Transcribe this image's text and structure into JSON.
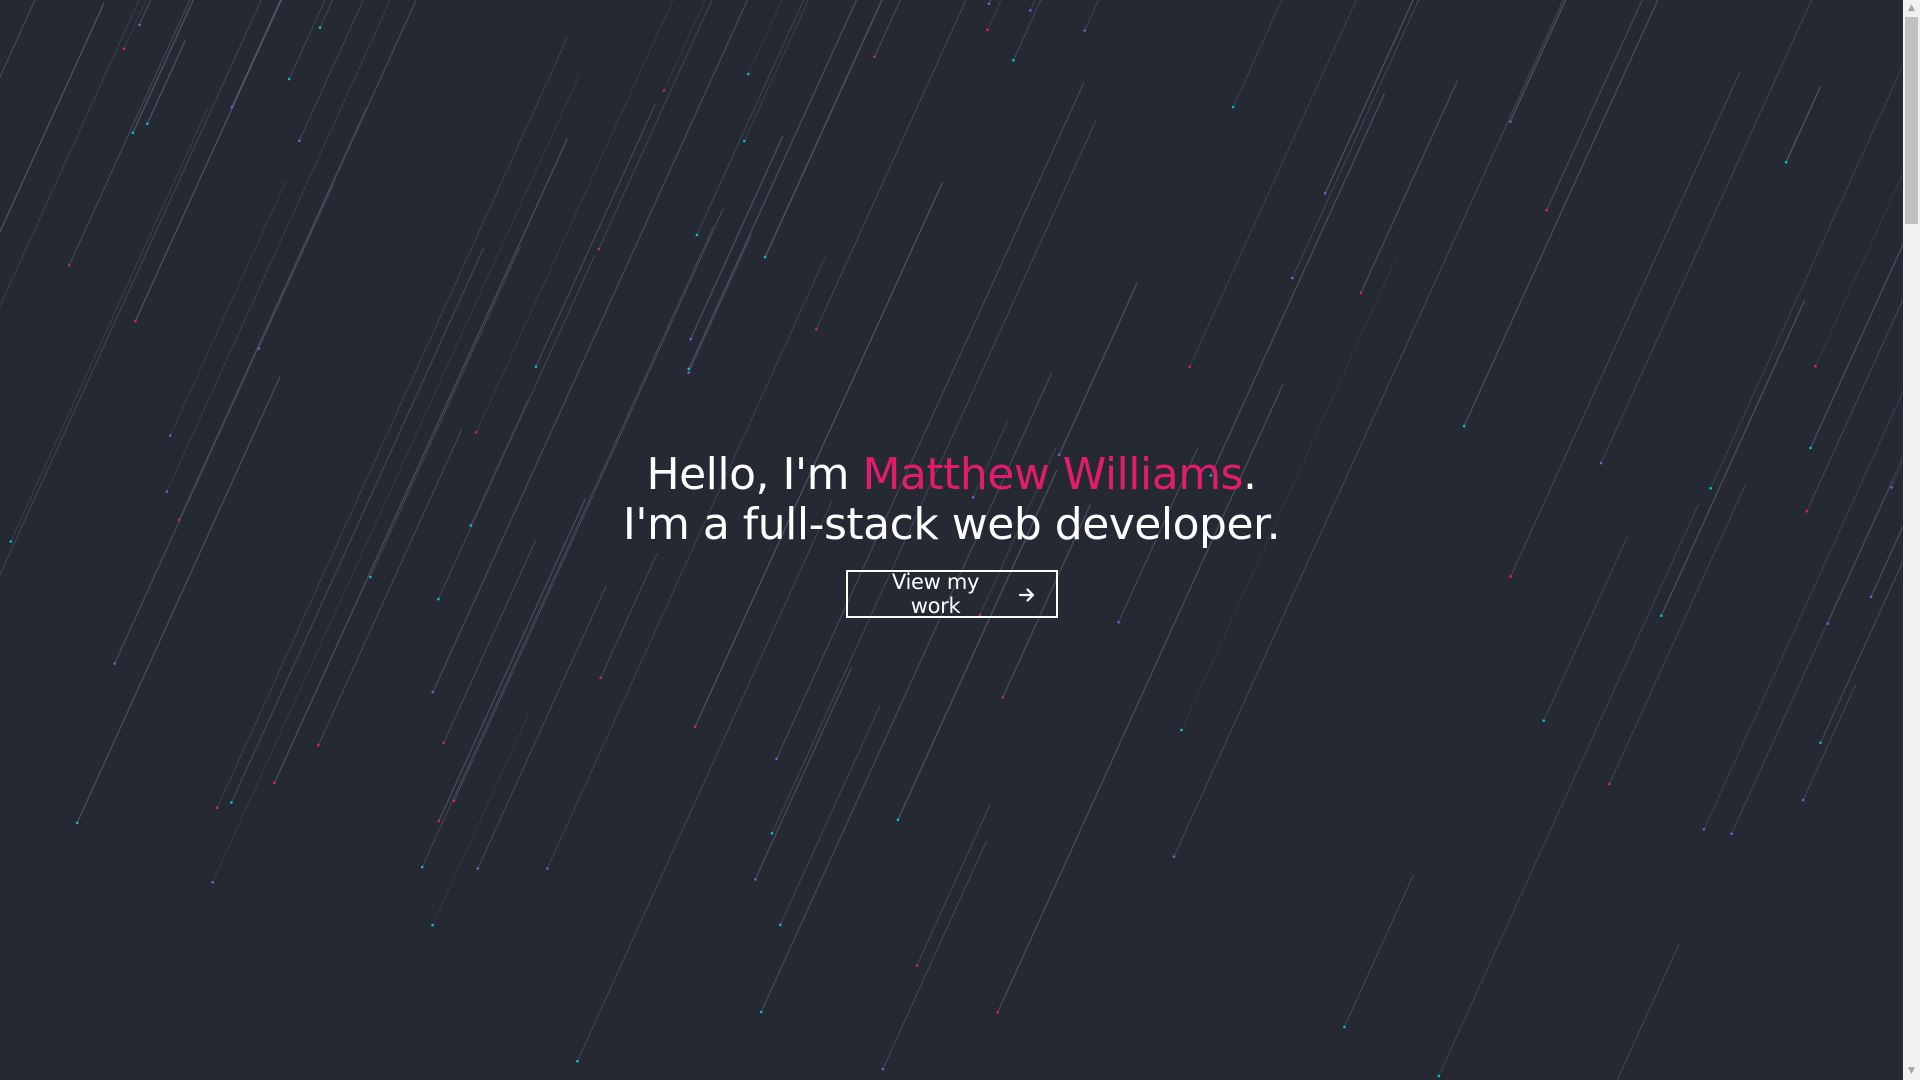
{
  "hero": {
    "greeting": "Hello, I'm ",
    "name": "Matthew Williams",
    "period": ".",
    "tagline": "I'm a full-stack web developer.",
    "cta_label": "View my work"
  },
  "icons": {
    "cta_icon": "arrow-right-icon",
    "scroll_up": "triangle-up-icon",
    "scroll_down": "triangle-down-icon"
  },
  "colors": {
    "background": "#252934",
    "accent": "#e31b6d",
    "text": "#ffffff",
    "streak": "#5b6276",
    "particle_pink": "#e31b6d",
    "particle_teal": "#04c2c9",
    "particle_purple": "#6b62d8"
  }
}
